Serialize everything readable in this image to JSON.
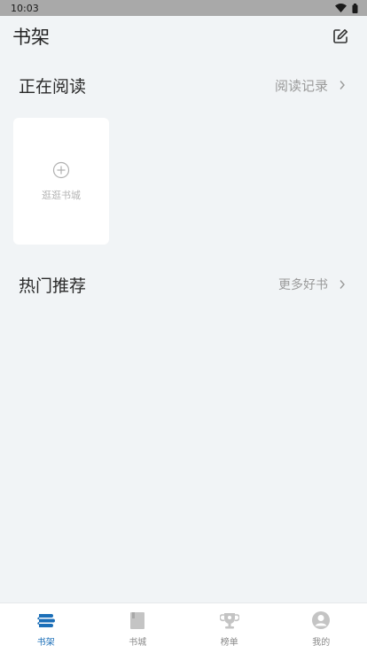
{
  "status_bar": {
    "time": "10:03"
  },
  "header": {
    "title": "书架",
    "edit_icon": "edit-icon"
  },
  "reading_section": {
    "title": "正在阅读",
    "link_label": "阅读记录"
  },
  "add_card": {
    "label": "逛逛书城"
  },
  "hot_section": {
    "title": "热门推荐",
    "link_label": "更多好书"
  },
  "bottom_nav": {
    "items": [
      {
        "label": "书架",
        "active": true
      },
      {
        "label": "书城",
        "active": false
      },
      {
        "label": "榜单",
        "active": false
      },
      {
        "label": "我的",
        "active": false
      }
    ]
  },
  "colors": {
    "accent": "#1c6fb8",
    "background": "#f1f4f6",
    "card": "#ffffff",
    "muted": "#9a9a9a"
  }
}
